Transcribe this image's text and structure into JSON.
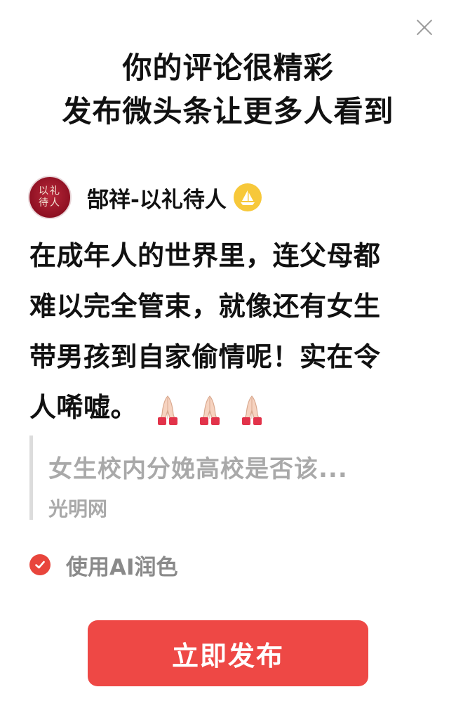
{
  "title": {
    "line1": "你的评论很精彩",
    "line2": "发布微头条让更多人看到"
  },
  "author": {
    "avatar_text": "以礼待人",
    "name": "郜祥-以礼待人",
    "badge_icon": "sailboat-icon",
    "badge_color": "#f7c83a"
  },
  "comment": {
    "lines": [
      "在成年人的世界里，连父母都",
      "难以完全管束，就像还有女生",
      "带男孩到自家偷情呢！实在令",
      "人唏嘘。"
    ],
    "emoji": [
      "🙏🏻",
      "🙏🏻",
      "🙏🏻"
    ]
  },
  "quote": {
    "title": "女生校内分娩高校是否该...",
    "source": "光明网"
  },
  "ai_polish": {
    "label": "使用AI润色",
    "checked": true,
    "check_color": "#e8453c"
  },
  "publish_button": {
    "label": "立即发布",
    "color": "#ee4845"
  },
  "close_icon": "close-icon"
}
